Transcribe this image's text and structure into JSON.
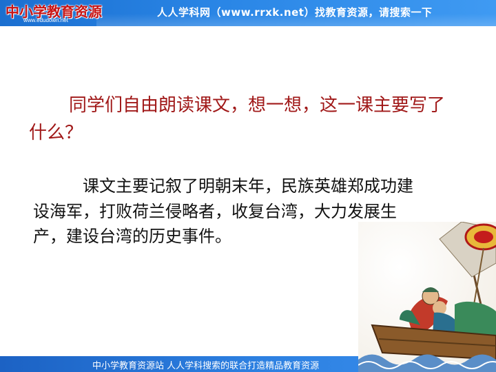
{
  "header": {
    "logo_text": "中小学教育资源",
    "logo_url": "www.edudown.net",
    "slogan": "人人学科网（www.rrxk.net）找教育资源，请搜索一下"
  },
  "content": {
    "question": "同学们自由朗读课文，想一想，这一课主要写了什么？",
    "answer": "课文主要记叙了明朝末年，民族英雄郑成功建设海军，打败荷兰侵略者，收复台湾，大力发展生产，建设台湾的历史事件。"
  },
  "footer": {
    "text": "中小学教育资源站 人人学科搜索的联合打造精品教育资源"
  },
  "colors": {
    "header_blue": "#2a86e6",
    "question_red": "#a01818",
    "answer_black": "#111111"
  }
}
